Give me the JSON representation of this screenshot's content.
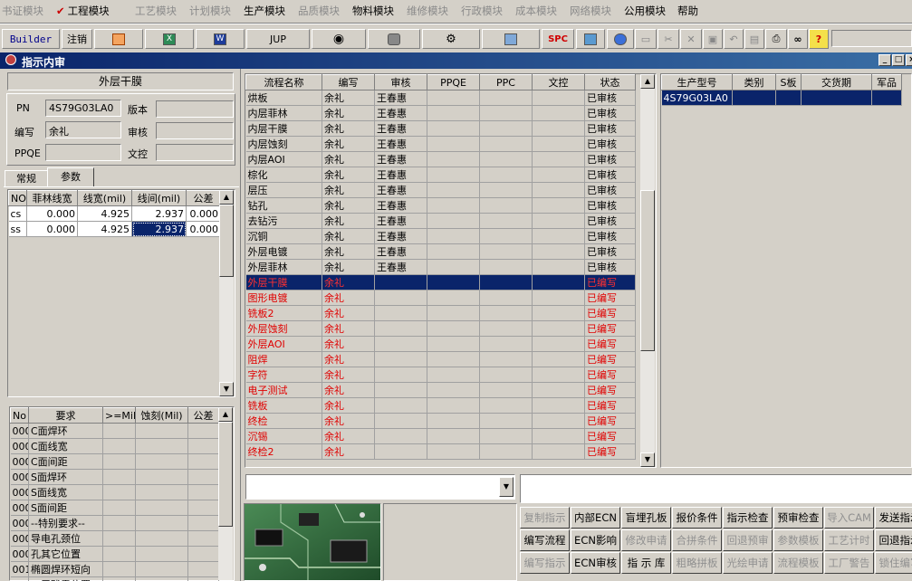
{
  "menubar": [
    "书证模块",
    "工程模块",
    "工艺模块",
    "计划模块",
    "生产模块",
    "品质模块",
    "物料模块",
    "维修模块",
    "行政模块",
    "成本模块",
    "网络模块",
    "公用模块",
    "帮助"
  ],
  "toolbar": {
    "builder": "Builder",
    "logout": "注销",
    "jup": "JUP",
    "spc": "SPC"
  },
  "window": {
    "title": "指示内审"
  },
  "left": {
    "header": "外层干膜",
    "pn_label": "PN",
    "pn_value": "4S79G03LA0",
    "version_label": "版本",
    "version_value": "",
    "author_label": "编写",
    "author_value": "余礼",
    "reviewer_label": "审核",
    "reviewer_value": "",
    "ppqe_label": "PPQE",
    "ppqe_value": "",
    "doc_label": "文控",
    "doc_value": "",
    "tabs": [
      "常规",
      "参数"
    ],
    "param_headers": [
      "NO.",
      "菲林线宽",
      "线宽(mil)",
      "线间(mil)",
      "公差"
    ],
    "param_rows": [
      [
        "cs",
        "0.000",
        "4.925",
        "2.937",
        "0.000"
      ],
      [
        "ss",
        "0.000",
        "4.925",
        "2.937",
        "0.000"
      ]
    ],
    "req_headers": [
      "No",
      "要求",
      ">=Mil",
      "蚀刻(Mil)",
      "公差"
    ],
    "req_rows": [
      [
        "000",
        "C面焊环"
      ],
      [
        "000",
        "C面线宽"
      ],
      [
        "000",
        "C面间距"
      ],
      [
        "000",
        "S面焊环"
      ],
      [
        "000",
        "S面线宽"
      ],
      [
        "000",
        "S面间距"
      ],
      [
        "000",
        "--特别要求--"
      ],
      [
        "000",
        "导电孔颈位"
      ],
      [
        "000",
        "孔其它位置"
      ],
      [
        "001",
        "椭圆焊环短向"
      ],
      [
        "",
        "…层残露位置"
      ]
    ]
  },
  "process": {
    "headers": [
      "流程名称",
      "编写",
      "审核",
      "PPQE",
      "PPC",
      "文控",
      "状态"
    ],
    "rows": [
      [
        "烘板",
        "余礼",
        "王春惠",
        "",
        "",
        "",
        "已审核"
      ],
      [
        "内层菲林",
        "余礼",
        "王春惠",
        "",
        "",
        "",
        "已审核"
      ],
      [
        "内层干膜",
        "余礼",
        "王春惠",
        "",
        "",
        "",
        "已审核"
      ],
      [
        "内层蚀刻",
        "余礼",
        "王春惠",
        "",
        "",
        "",
        "已审核"
      ],
      [
        "内层AOI",
        "余礼",
        "王春惠",
        "",
        "",
        "",
        "已审核"
      ],
      [
        "棕化",
        "余礼",
        "王春惠",
        "",
        "",
        "",
        "已审核"
      ],
      [
        "层压",
        "余礼",
        "王春惠",
        "",
        "",
        "",
        "已审核"
      ],
      [
        "钻孔",
        "余礼",
        "王春惠",
        "",
        "",
        "",
        "已审核"
      ],
      [
        "去钻污",
        "余礼",
        "王春惠",
        "",
        "",
        "",
        "已审核"
      ],
      [
        "沉铜",
        "余礼",
        "王春惠",
        "",
        "",
        "",
        "已审核"
      ],
      [
        "外层电镀",
        "余礼",
        "王春惠",
        "",
        "",
        "",
        "已审核"
      ],
      [
        "外层菲林",
        "余礼",
        "王春惠",
        "",
        "",
        "",
        "已审核"
      ],
      [
        "外层干膜",
        "余礼",
        "",
        "",
        "",
        "",
        "已编写"
      ],
      [
        "图形电镀",
        "余礼",
        "",
        "",
        "",
        "",
        "已编写"
      ],
      [
        "铣板2",
        "余礼",
        "",
        "",
        "",
        "",
        "已编写"
      ],
      [
        "外层蚀刻",
        "余礼",
        "",
        "",
        "",
        "",
        "已编写"
      ],
      [
        "外层AOI",
        "余礼",
        "",
        "",
        "",
        "",
        "已编写"
      ],
      [
        "阻焊",
        "余礼",
        "",
        "",
        "",
        "",
        "已编写"
      ],
      [
        "字符",
        "余礼",
        "",
        "",
        "",
        "",
        "已编写"
      ],
      [
        "电子测试",
        "余礼",
        "",
        "",
        "",
        "",
        "已编写"
      ],
      [
        "铣板",
        "余礼",
        "",
        "",
        "",
        "",
        "已编写"
      ],
      [
        "终检",
        "余礼",
        "",
        "",
        "",
        "",
        "已编写"
      ],
      [
        "沉锡",
        "余礼",
        "",
        "",
        "",
        "",
        "已编写"
      ],
      [
        "终检2",
        "余礼",
        "",
        "",
        "",
        "",
        "已编写"
      ]
    ]
  },
  "product": {
    "headers": [
      "生产型号",
      "类别",
      "S板",
      "交货期",
      "军品"
    ],
    "rows": [
      [
        "4S79G03LA0",
        "",
        "",
        "",
        ""
      ]
    ]
  },
  "buttons": [
    [
      "复制指示",
      "内部ECN",
      "盲埋孔板",
      "报价条件",
      "指示检查",
      "预审检查",
      "导入CAM",
      "发送指示"
    ],
    [
      "编写流程",
      "ECN影响",
      "修改申请",
      "合拼条件",
      "回退预审",
      "参数模板",
      "工艺计时",
      "回退指示"
    ],
    [
      "编写指示",
      "ECN审核",
      "指 示 库",
      "粗略拼板",
      "光绘申请",
      "流程模板",
      "工厂警告",
      "锁住编写"
    ]
  ],
  "buttons_disabled": [
    [
      true,
      false,
      false,
      false,
      false,
      false,
      true,
      false
    ],
    [
      false,
      false,
      true,
      true,
      true,
      true,
      true,
      false
    ],
    [
      true,
      false,
      false,
      true,
      true,
      true,
      true,
      true
    ]
  ]
}
